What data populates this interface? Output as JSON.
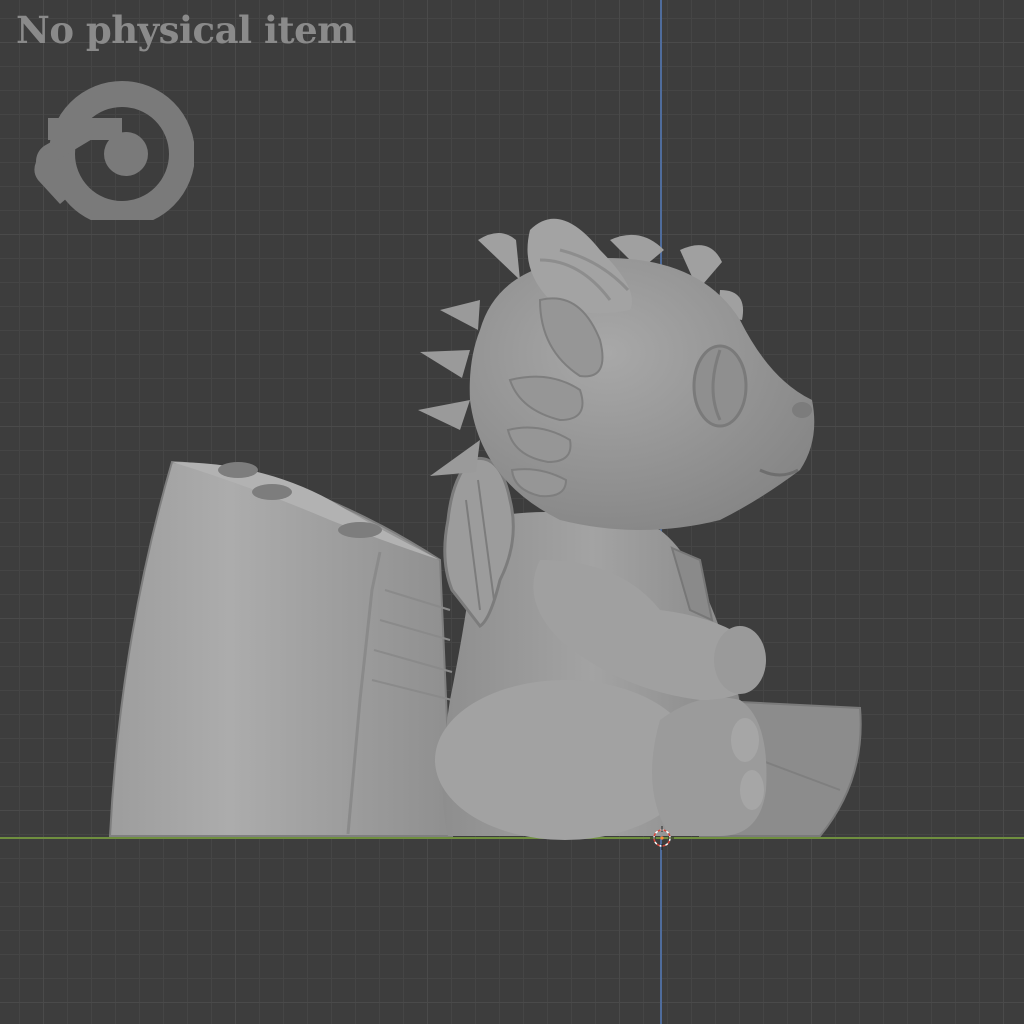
{
  "viewport": {
    "watermark": {
      "text": "No physical item"
    },
    "logo": {
      "name": "blender-logo"
    },
    "axes": {
      "x_color": "#6f8f3f",
      "z_color": "#4f6c9c"
    },
    "model": {
      "name": "dragon-pen-holder",
      "color": "#9a9a9a"
    },
    "cursor": {
      "name": "3d-cursor-icon"
    }
  }
}
